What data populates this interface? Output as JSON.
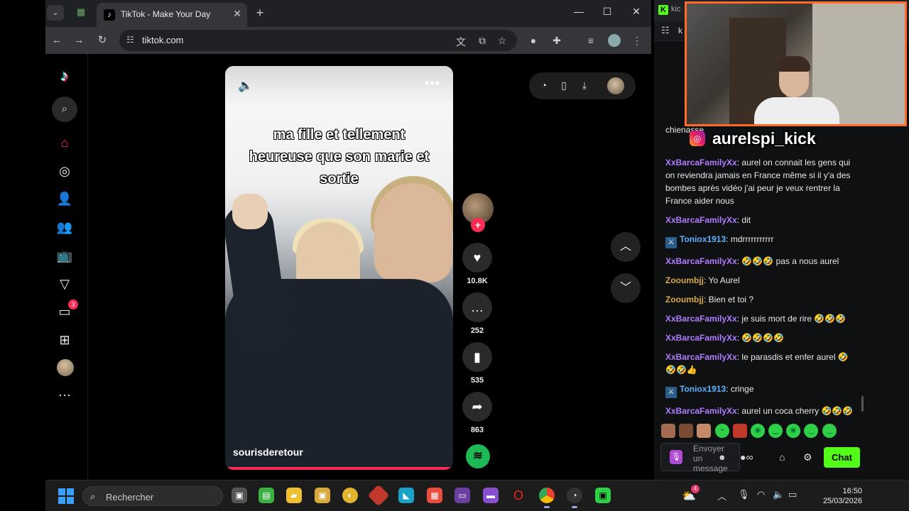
{
  "browser": {
    "tab_title": "TikTok - Make Your Day",
    "url": "tiktok.com"
  },
  "tiktok": {
    "caption_lines": [
      "ma fille et tellement",
      "heureuse que son marie et",
      "sortie"
    ],
    "author": "sourisderetour",
    "likes": "10.8K",
    "comments": "252",
    "saves": "535",
    "shares": "863",
    "inbox_badge": "3",
    "progress": 1.0
  },
  "kick": {
    "tab_text": "kic",
    "bar_text": "k",
    "instagram_handle": "aurelspi_kick",
    "partial_top_message": "chienasse",
    "messages": [
      {
        "user": "XxBarcaFamilyXx",
        "color": "purple",
        "mod": false,
        "text": "aurel on connait les gens qui on reviendra jamais en France même si il y'a des bombes après vidéo j'ai peur je veux rentrer la France aider nous"
      },
      {
        "user": "XxBarcaFamilyXx",
        "color": "purple",
        "mod": false,
        "text": "dit"
      },
      {
        "user": "Toniox1913",
        "color": "blue",
        "mod": true,
        "text": "mdrrrrrrrrrrr"
      },
      {
        "user": "XxBarcaFamilyXx",
        "color": "purple",
        "mod": false,
        "text": "🤣🤣🤣 pas a nous aurel"
      },
      {
        "user": "Zooumbjj",
        "color": "gold",
        "mod": false,
        "text": "Yo Aurel"
      },
      {
        "user": "Zooumbjj",
        "color": "gold",
        "mod": false,
        "text": "Bien et toi ?"
      },
      {
        "user": "XxBarcaFamilyXx",
        "color": "purple",
        "mod": false,
        "text": "je suis mort de rire 🤣🤣🤣"
      },
      {
        "user": "XxBarcaFamilyXx",
        "color": "purple",
        "mod": false,
        "text": "🤣🤣🤣🤣"
      },
      {
        "user": "XxBarcaFamilyXx",
        "color": "purple",
        "mod": false,
        "text": "le parasdis et enfer aurel 🤣🤣🤣👍"
      },
      {
        "user": "Toniox1913",
        "color": "blue",
        "mod": true,
        "text": "cringe"
      },
      {
        "user": "XxBarcaFamilyXx",
        "color": "purple",
        "mod": false,
        "text": "aurel un coca cherry 🤣🤣🤣"
      }
    ],
    "input_placeholder": "Envoyer un message",
    "chat_button": "Chat"
  },
  "taskbar": {
    "search_placeholder": "Rechercher",
    "time": "16:50",
    "date": "25/03/2026",
    "weather_badge": "4"
  },
  "colors": {
    "tiktok_pink": "#fe2c55",
    "kick_green": "#53fc18",
    "webcam_border": "#ff6a2a"
  }
}
